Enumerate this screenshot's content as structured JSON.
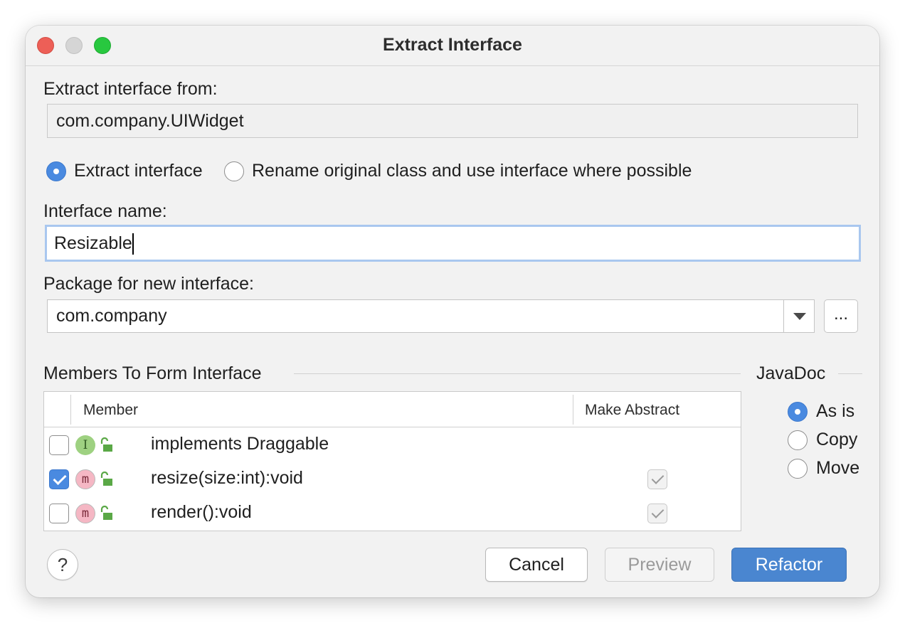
{
  "window": {
    "title": "Extract Interface"
  },
  "extract_from": {
    "label": "Extract interface from:",
    "value": "com.company.UIWidget"
  },
  "mode": {
    "options": [
      {
        "label": "Extract interface",
        "selected": true
      },
      {
        "label": "Rename original class and use interface where possible",
        "selected": false
      }
    ]
  },
  "interface_name": {
    "label": "Interface name:",
    "value": "Resizable"
  },
  "package": {
    "label": "Package for new interface:",
    "value": "com.company",
    "browse_label": "..."
  },
  "members": {
    "section_title": "Members To Form Interface",
    "columns": {
      "member": "Member",
      "make_abstract": "Make Abstract"
    },
    "rows": [
      {
        "checked": false,
        "kind": "I",
        "visibility": "public",
        "name": "implements Draggable",
        "make_abstract": null
      },
      {
        "checked": true,
        "kind": "m",
        "visibility": "public",
        "name": "resize(size:int):void",
        "make_abstract": true
      },
      {
        "checked": false,
        "kind": "m",
        "visibility": "public",
        "name": "render():void",
        "make_abstract": true
      }
    ]
  },
  "javadoc": {
    "section_title": "JavaDoc",
    "options": [
      {
        "label": "As is",
        "selected": true
      },
      {
        "label": "Copy",
        "selected": false
      },
      {
        "label": "Move",
        "selected": false
      }
    ]
  },
  "buttons": {
    "help": "?",
    "cancel": "Cancel",
    "preview": "Preview",
    "refactor": "Refactor"
  },
  "colors": {
    "accent": "#4a86d0",
    "interface_icon": "#9ed181",
    "method_icon": "#f5b7c4",
    "lock": "#5aa846"
  }
}
